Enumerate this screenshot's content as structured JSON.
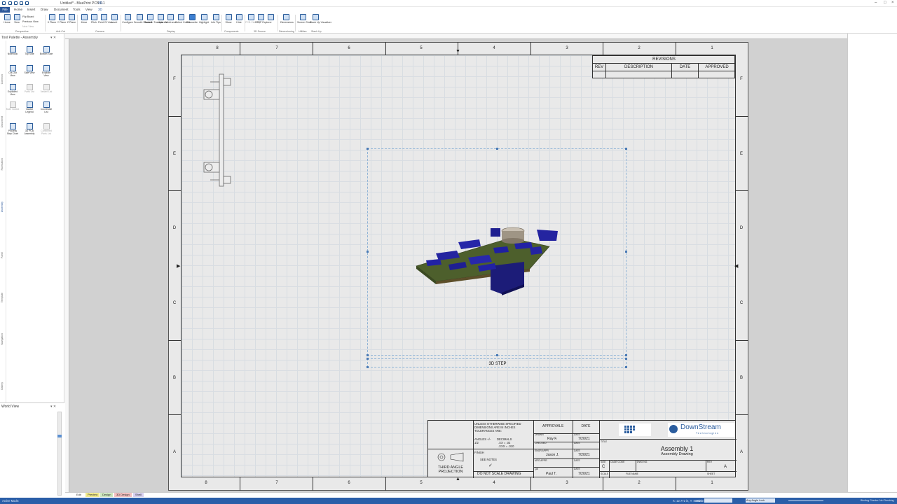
{
  "app": {
    "title": "Untitled* - BluePrint PCB 6.1",
    "tab_hint": "3D"
  },
  "menu": {
    "file": "File",
    "items": [
      "Home",
      "Insert",
      "Draw",
      "Document",
      "Tools",
      "View",
      "3D"
    ]
  },
  "ribbon": {
    "buttons": [
      "Home",
      "View",
      "Flip Board",
      "Previous View",
      "Next View",
      "X Plane",
      "Y Plane",
      "Z Plane",
      "Move",
      "Pitch",
      "Field Of View",
      "Level",
      "Configure",
      "Smooth Shaded",
      "Smooth Transparent",
      "Hide",
      "Wireframe",
      "Select Colors",
      "Silhouette",
      "Highlight",
      "Info Tips",
      "Show",
      "Hide",
      "PCB Visibility",
      "STEP Explorer",
      "Dimensions",
      "Screen Shot",
      "Stack Up Visualizer"
    ],
    "groups": [
      "Perspective",
      "Anti-Cut",
      "Camera",
      "Display",
      "Components",
      "3D Source",
      "Dimensioning",
      "Utilities",
      "Stack Up"
    ]
  },
  "palette": {
    "title": "Tool Palette - Assembly",
    "side_tabs": [
      "Common",
      "Document",
      "Fabrication",
      "Assembly",
      "Panel",
      "Template",
      "Navigation",
      "Gallery"
    ],
    "items": [
      {
        "label": "Notebook",
        "enabled": true
      },
      {
        "label": "Top Side",
        "enabled": true
      },
      {
        "label": "Bottom Side",
        "enabled": true
      },
      {
        "label": "Cut-Out View",
        "enabled": true
      },
      {
        "label": "Side View",
        "enabled": true
      },
      {
        "label": "Explode View",
        "enabled": true
      },
      {
        "label": "Exploded View",
        "enabled": true
      },
      {
        "label": "Parts List",
        "enabled": false
      },
      {
        "label": "Variant List",
        "enabled": false
      },
      {
        "label": "Multi Variant",
        "enabled": false
      },
      {
        "label": "Variant Legend",
        "enabled": true
      },
      {
        "label": "Coordinate List",
        "enabled": true
      },
      {
        "label": "Process Step Chart",
        "enabled": true
      },
      {
        "label": "3D PCB Assembly",
        "enabled": true
      },
      {
        "label": "Combined Parts List",
        "enabled": false
      }
    ]
  },
  "world_view": {
    "title": "World View"
  },
  "drawing": {
    "zones_top": [
      "8",
      "7",
      "6",
      "5",
      "4",
      "3",
      "2",
      "1"
    ],
    "zones_side": [
      "F",
      "E",
      "D",
      "C",
      "B",
      "A"
    ],
    "revisions": {
      "title": "REVISIONS",
      "headers": [
        "REV",
        "DESCRIPTION",
        "DATE",
        "APPROVED"
      ]
    },
    "step_label": "3D STEP",
    "title_block": {
      "notes": "UNLESS OTHERWISE SPECIFIED DIMENSIONS ARE IN INCHES TOLERANCES ARE:",
      "angles": "ANGLES +/- 1/2",
      "decimals": "DECIMALS",
      "dec1": ".XX = .02",
      "dec2": ".XXX = .010",
      "approvals": "APPROVALS",
      "date": "DATE",
      "drawn": "DRAWN",
      "drawn_by": "Ray F.",
      "drawn_date": "7/20/21",
      "checked": "CHECKED",
      "eng_appr": "ENGR APPR",
      "eng_by": "Jason J.",
      "eng_date": "7/20/21",
      "mfg_appr": "MFG APPR",
      "qa": "QA",
      "qa_by": "Paul T.",
      "qa_date": "7/20/21",
      "finish": "FINISH",
      "see_notes": "SEE NOTES",
      "projection": "THIRD ANGLE PROJECTION",
      "no_scale": "DO NOT SCALE DRAWING",
      "company": "DownStream",
      "company_sub": "Technologies",
      "title_label": "TITLE",
      "title": "Assembly 1",
      "subtitle": "Assembly Drawing",
      "size": "SIZE",
      "size_val": "C",
      "cage": "CAGE CODE",
      "dwg": "DWG NO.",
      "rev": "REV",
      "rev_val": "A",
      "scale": "SCALE",
      "file_name": "FILE NAME",
      "sheet": "SHEET"
    }
  },
  "sheet_tabs": [
    "Edit",
    "Preview",
    "Design",
    "3D Design",
    "Shell"
  ],
  "status": {
    "mode": "Active Mode:",
    "coords": "X: 12.772 in, Y: 8.952 in",
    "units": "Units:",
    "angle": "Any Angle Lock",
    "checks": "Binding Checks: No Checking"
  }
}
